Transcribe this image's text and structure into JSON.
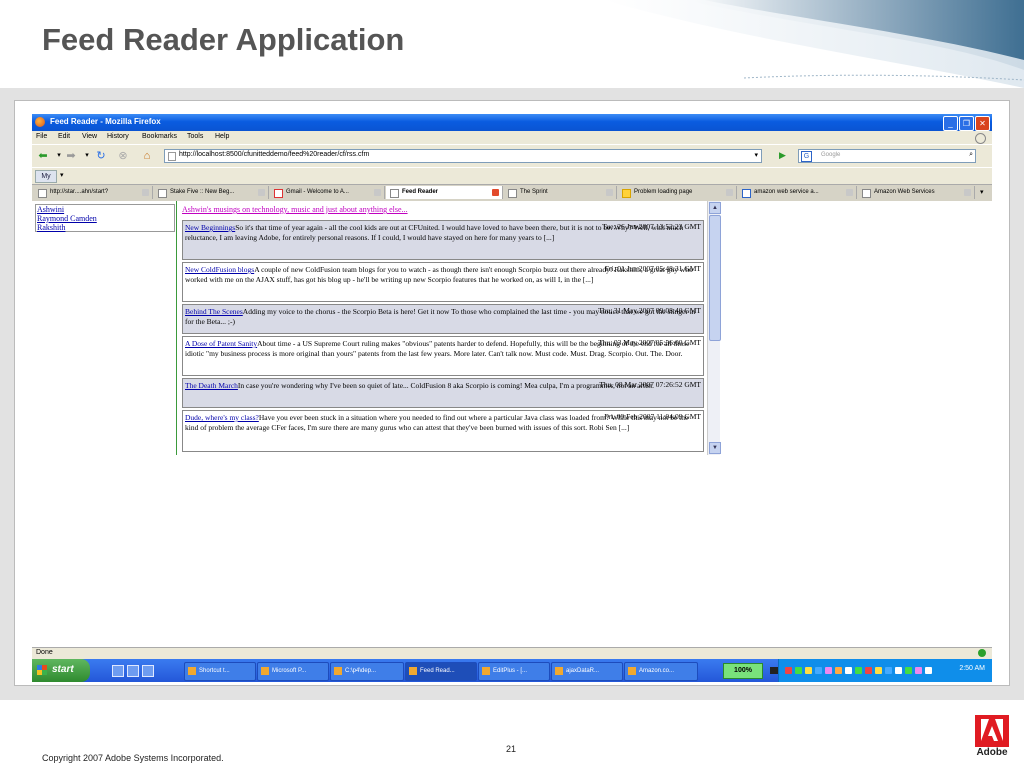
{
  "slide": {
    "title": "Feed Reader Application",
    "copyright": "Copyright 2007 Adobe Systems Incorporated.",
    "page_number": "21",
    "brand": "Adobe"
  },
  "browser": {
    "window_title": "Feed Reader - Mozilla Firefox",
    "menu": [
      "File",
      "Edit",
      "View",
      "History",
      "Bookmarks",
      "Tools",
      "Help"
    ],
    "url": "http://localhost:8500/cfunitteddemo/feed%20reader/cf/rss.cfm",
    "search_placeholder": "Google",
    "bookmark_button": "My",
    "tabs": [
      {
        "label": "http://star....ahn/start?",
        "active": false
      },
      {
        "label": "Stake Five :: New Beg...",
        "active": false
      },
      {
        "label": "Gmail - Welcome to A...",
        "active": false
      },
      {
        "label": "Feed Reader",
        "active": true
      },
      {
        "label": "The Sprint",
        "active": false
      },
      {
        "label": "Problem loading page",
        "active": false
      },
      {
        "label": "amazon web service a...",
        "active": false
      },
      {
        "label": "Amazon Web Services",
        "active": false
      }
    ],
    "status": "Done"
  },
  "authors": [
    "Ashwini",
    "Raymond Camden",
    "Rakshith"
  ],
  "feed": {
    "heading": "Ashwin's musings on technology, music and just about anything else...",
    "entries": [
      {
        "title": "New Beginnings",
        "date": "Tue, 26 Jun 2007 13:52:23 GMT",
        "text": "So it's that time of year again - all the cool kids are out at CFUnited. I would have loved to have been there, but it is not to be. Why? Well, with much reluctance, I am leaving Adobe, for entirely personal reasons. If I could, I would have stayed on here for many years to [...]"
      },
      {
        "title": "New ColdFusion blogs",
        "date": "Fri, 01 Jun 2007 05:48:31 GMT",
        "text": "A couple of new ColdFusion team blogs for you to watch - as though there isn't enough Scorpio buzz out there already! Rakshith, a great guy who worked with me on the AJAX stuff, has got his blog up - he'll be writing up new Scorpio features that he worked on, as will I, in the [...]"
      },
      {
        "title": "Behind The Scenes",
        "date": "Thu, 31 May 2007 09:08:40 GMT",
        "text": "Adding my voice to the chorus - the Scorpio Beta is here! Get it now To those who complained the last time - you may notice that we got the stinger in for the Beta... ;-)"
      },
      {
        "title": "A Dose of Patent Sanity",
        "date": "Thu, 03 May 2007 05:56:00 GMT",
        "text": "About time - a US Supreme Court ruling makes \"obvious\" patents harder to defend. Hopefully, this will be the beginning of the end for all those idiotic \"my business process is more original than yours\" patents from the last few years. More later. Can't talk now. Must code. Must. Drag. Scorpio. Out. The. Door."
      },
      {
        "title": "The Death March",
        "date": "Thu, 08 Mar 2007 07:26:52 GMT",
        "text": "In case you're wondering why I've been so quiet of late... ColdFusion 8 aka Scorpio is coming! Mea culpa, I'm a programmer, not an artist."
      },
      {
        "title": "Dude, where's my class?",
        "date": "Fri, 09 Feb 2007 11:04:09 GMT",
        "text": "Have you ever been stuck in a situation where you needed to find out where a particular Java class was loaded from? While this may not be the kind of problem the average CFer faces, I'm sure there are many gurus who can attest that they've been burned with issues of this sort. Robi Sen [...]"
      }
    ]
  },
  "taskbar": {
    "start": "start",
    "tasks": [
      "Shortcut t...",
      "Microsoft P...",
      "C:\\p4\\dep...",
      "Feed Read...",
      "EditPlus - [...",
      "ajaxDataR...",
      "Amazon.co..."
    ],
    "zoom": "100%",
    "clock": "2:50 AM"
  },
  "colors": {
    "titlebar": "#0a5ce0",
    "link": "#0000aa",
    "feed_heading": "#c000c0",
    "entry_shade": "#d8dae6",
    "adobe_red": "#e01b22"
  }
}
